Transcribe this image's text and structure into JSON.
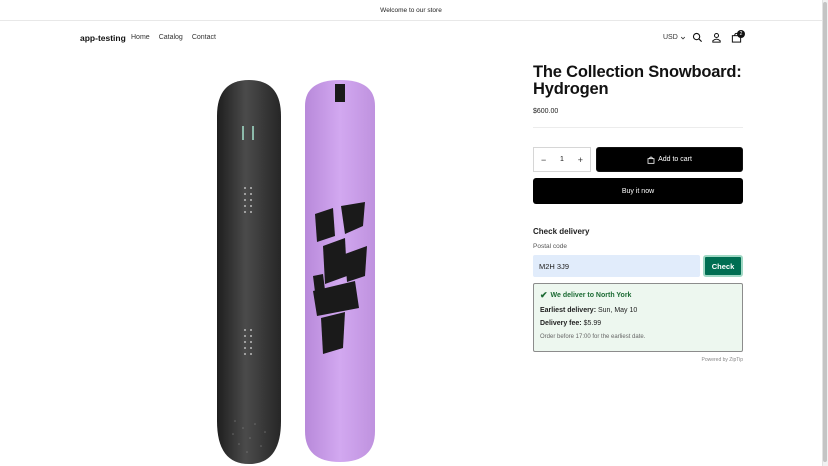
{
  "announcement": {
    "text": "Welcome to our store"
  },
  "header": {
    "logo": "app-testing",
    "nav": [
      "Home",
      "Catalog",
      "Contact"
    ],
    "currency": "USD",
    "cart_count": "2",
    "icons": [
      "search-icon",
      "account-icon",
      "cart-icon"
    ]
  },
  "product": {
    "title": "The Collection Snowboard: Hydrogen",
    "price": "$600.00",
    "quantity": "1",
    "add_to_cart_label": "Add to cart",
    "buy_now_label": "Buy it now"
  },
  "delivery": {
    "title": "Check delivery",
    "postal_label": "Postal code",
    "postal_value": "M2H 3J9",
    "check_label": "Check",
    "result_headline": "We deliver to North York",
    "earliest_label": "Earliest delivery:",
    "earliest_value": "Sun, May 10",
    "fee_label": "Delivery fee:",
    "fee_value": "$5.99",
    "note": "Order before 17:00 for the earliest date.",
    "powered_by": "Powered by ZipTip"
  },
  "colors": {
    "accent_green": "#006e52",
    "board_purple": "#c89ae6",
    "board_dark": "#3a3a3a",
    "result_bg": "#edf7ef"
  }
}
